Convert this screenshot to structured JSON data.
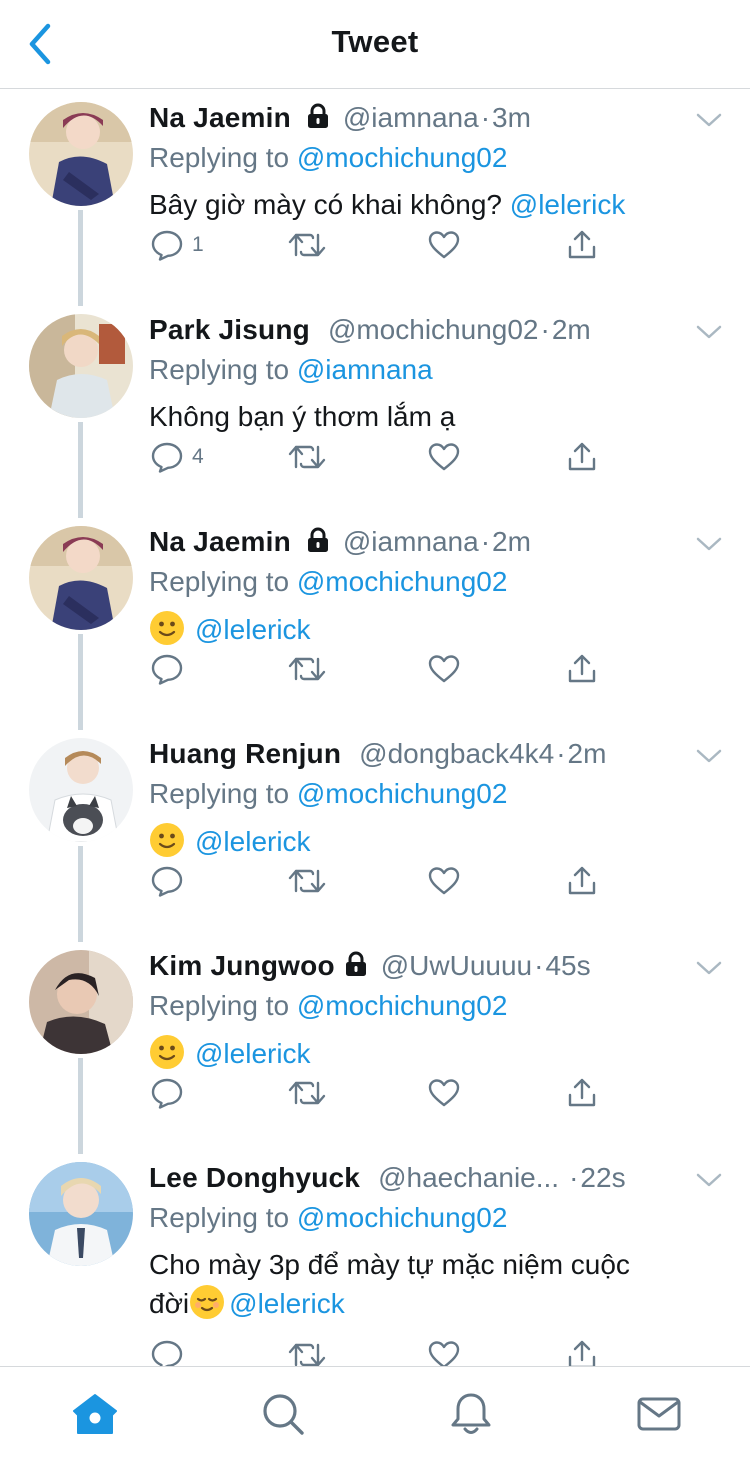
{
  "header": {
    "title": "Tweet"
  },
  "tweets": [
    {
      "name": "Na Jaemin",
      "locked": true,
      "handle": "@iamnana",
      "time": "3m",
      "replying_prefix": "Replying to",
      "replying_to": "@mochichung02",
      "text": "Bây giờ mày có khai không?",
      "mention": "@lelerick",
      "reply_count": "1"
    },
    {
      "name": "Park Jisung",
      "locked": false,
      "handle": "@mochichung02",
      "time": "2m",
      "replying_prefix": "Replying to",
      "replying_to": "@iamnana",
      "text": "Không bạn ý thơm lắm ạ",
      "mention": "",
      "reply_count": "4"
    },
    {
      "name": "Na Jaemin",
      "locked": true,
      "handle": "@iamnana",
      "time": "2m",
      "replying_prefix": "Replying to",
      "replying_to": "@mochichung02",
      "emoji": "slightly-smiling-face",
      "mention": "@lelerick",
      "reply_count": ""
    },
    {
      "name": "Huang Renjun",
      "locked": false,
      "handle": "@dongback4k4",
      "time": "2m",
      "replying_prefix": "Replying to",
      "replying_to": "@mochichung02",
      "emoji": "slightly-smiling-face",
      "mention": "@lelerick",
      "reply_count": ""
    },
    {
      "name": "Kim Jungwoo",
      "locked": true,
      "handle": "@UwUuuuu",
      "time": "45s",
      "replying_prefix": "Replying to",
      "replying_to": "@mochichung02",
      "emoji": "slightly-smiling-face",
      "mention": "@lelerick",
      "reply_count": ""
    },
    {
      "name": "Lee Donghyuck",
      "locked": false,
      "handle": "@haechanie...",
      "time": "22s",
      "replying_prefix": "Replying to",
      "replying_to": "@mochichung02",
      "text_line1": "Cho mày 3p để mày tự mặc niệm cuộc",
      "text_line2": "đời",
      "emoji": "relieved-face",
      "mention": "@lelerick",
      "reply_count": ""
    }
  ],
  "tabbar": {
    "items": [
      "home-icon",
      "search-icon",
      "notifications-icon",
      "messages-icon"
    ],
    "active": "home-icon"
  },
  "colors": {
    "accent": "#1b95e0",
    "secondary_text": "#657786",
    "thread_line": "#ccd6dd"
  }
}
